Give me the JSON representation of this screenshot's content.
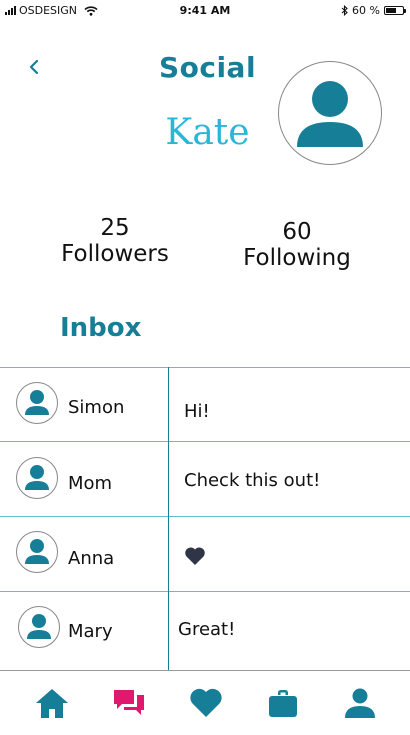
{
  "status_bar": {
    "carrier": "OSDESIGN",
    "time": "9:41 AM",
    "battery": "60 %",
    "battery_level": 0.6,
    "icons": [
      "signal-icon",
      "wifi-icon",
      "bluetooth-icon",
      "battery-icon"
    ]
  },
  "header": {
    "title": "Social",
    "username": "Kate",
    "back_icon": "chevron-left-icon",
    "avatar_icon": "user-icon"
  },
  "stats": {
    "followers_count": "25",
    "followers_label": "Followers",
    "following_count": "60",
    "following_label": "Following"
  },
  "inbox": {
    "title": "Inbox",
    "messages": [
      {
        "name": "Simon",
        "message": "Hi!"
      },
      {
        "name": "Mom",
        "message": "Check this out!"
      },
      {
        "name": "Anna",
        "message": "",
        "message_icon": "heart-icon"
      },
      {
        "name": "Mary",
        "message": "Great!"
      }
    ]
  },
  "bottom_nav": {
    "items": [
      {
        "icon": "home-icon",
        "active": false
      },
      {
        "icon": "chat-icon",
        "active": true
      },
      {
        "icon": "heart-icon",
        "active": false
      },
      {
        "icon": "briefcase-icon",
        "active": false
      },
      {
        "icon": "user-icon",
        "active": false
      }
    ]
  },
  "colors": {
    "primary": "#177e97",
    "accent_name": "#2ab6d6",
    "active_nav": "#e0196e",
    "divider": "#5fbecf",
    "heart_dark": "#2f3447"
  }
}
